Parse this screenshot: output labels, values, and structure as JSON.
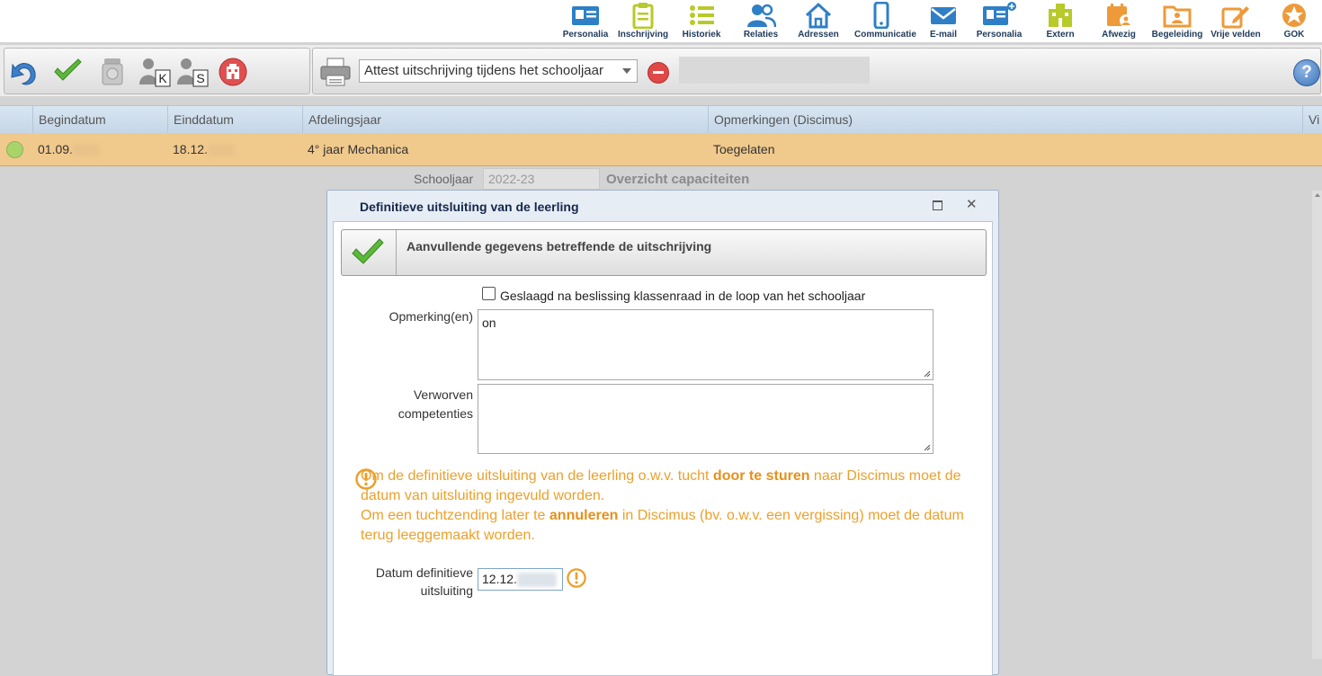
{
  "nav": [
    {
      "label": "Personalia",
      "icon": "id-card-icon",
      "color": "#2e7fc6"
    },
    {
      "label": "Inschrijving",
      "icon": "clipboard-icon",
      "color": "#b8c92a"
    },
    {
      "label": "Historiek",
      "icon": "list-icon",
      "color": "#b8c92a"
    },
    {
      "label": "Relaties",
      "icon": "people-icon",
      "color": "#2e7fc6"
    },
    {
      "label": "Adressen",
      "icon": "house-icon",
      "color": "#2e7fc6"
    },
    {
      "label": "Communicatie",
      "icon": "phone-icon",
      "color": "#2e7fc6"
    },
    {
      "label": "E-mail",
      "icon": "envelope-icon",
      "color": "#2e7fc6"
    },
    {
      "label": "Personalia",
      "icon": "id-card-plus-icon",
      "color": "#2e7fc6"
    },
    {
      "label": "Extern",
      "icon": "building-icon",
      "color": "#b8c92a"
    },
    {
      "label": "Afwezig",
      "icon": "calendar-person-icon",
      "color": "#ee9a3a"
    },
    {
      "label": "Begeleiding",
      "icon": "folder-person-icon",
      "color": "#ee9a3a"
    },
    {
      "label": "Vrije velden",
      "icon": "edit-icon",
      "color": "#ee9a3a"
    },
    {
      "label": "GOK",
      "icon": "star-circle-icon",
      "color": "#ee9a3a"
    }
  ],
  "toolbar": {
    "attest_select": "Attest uitschrijving tijdens het schooljaar",
    "k_label": "K",
    "s_label": "S"
  },
  "grid": {
    "headers": [
      "Begindatum",
      "Einddatum",
      "Afdelingsjaar",
      "Opmerkingen (Discimus)",
      "Vi"
    ],
    "row": {
      "begindatum": "01.09.",
      "einddatum": "18.12.",
      "afdelingsjaar": "4° jaar Mechanica",
      "opmerkingen": "Toegelaten",
      "status_color": "#a8d46a"
    }
  },
  "schooljaar": {
    "label": "Schooljaar",
    "value": "2022-23",
    "link": "Overzicht capaciteiten"
  },
  "dialog": {
    "title": "Definitieve uitsluiting van de leerling",
    "section_title": "Aanvullende gegevens betreffende de uitschrijving",
    "checkbox_label": "Geslaagd na beslissing klassenraad in de loop van het schooljaar",
    "opmerkingen_label": "Opmerking(en)",
    "opmerkingen_value": "on",
    "competenties_label_1": "Verworven",
    "competenties_label_2": "competenties",
    "competenties_value": "",
    "warning": {
      "p1_pre": "Om de definitieve uitsluiting van de leerling o.w.v. tucht ",
      "p1_bold": "door te sturen",
      "p1_post": " naar Discimus moet de datum van uitsluiting ingevuld worden.",
      "p2_pre": "Om een tuchtzending later te ",
      "p2_bold": "annuleren",
      "p2_post": " in Discimus (bv. o.w.v. een vergissing) moet de datum terug leeggemaakt worden."
    },
    "datum_label_1": "Datum definitieve",
    "datum_label_2": "uitsluiting",
    "datum_value": "12.12."
  },
  "colors": {
    "accent_blue": "#2e7fc6",
    "warning_orange": "#eca02a",
    "row_highlight": "#f0c98d"
  }
}
